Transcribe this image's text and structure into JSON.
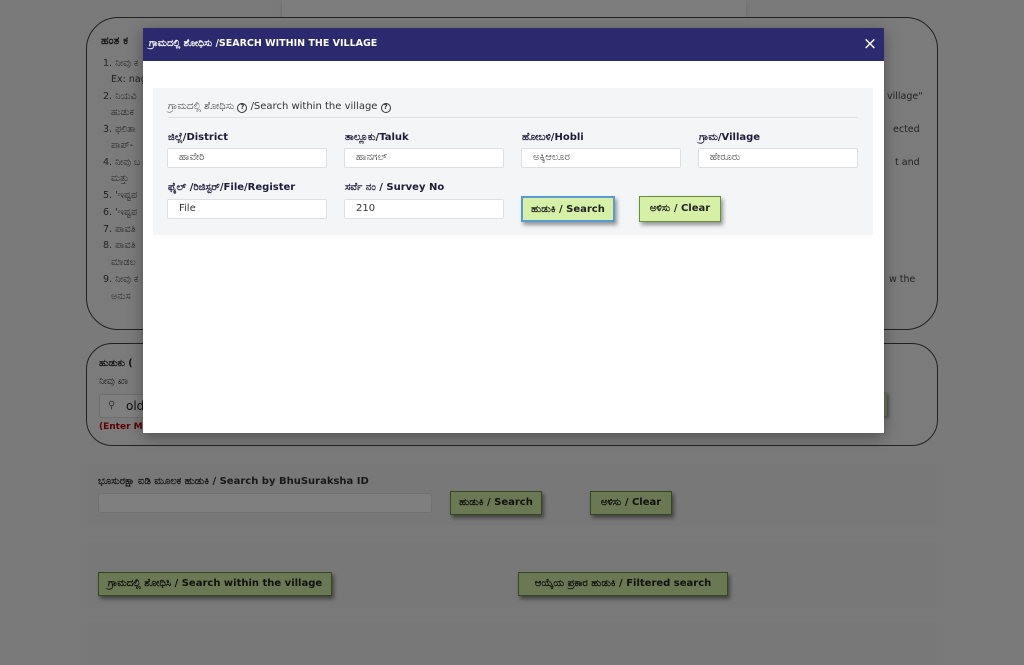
{
  "background": {
    "steps_title": "ಹಂತ ಕ",
    "steps": [
      "1. ನೀವು ಕ",
      "Ex: nag",
      "2. ನಿಯವಿ",
      "ಹುಡುಕ",
      "3. ಫಲಿತಾ",
      "ಪಾಪ್-",
      "4. ನೀವು ಬ",
      "ಮತ್ತು ",
      "5. 'ಇಷ್ಟಪ",
      "6. 'ಇಷ್ಟಪ",
      "7. ಪಾವತಿ",
      "8. ಪಾವತಿ",
      "ಮಾಡಲ",
      "9. ನೀವು ಕ",
      "ಅನುಸ"
    ],
    "steps_right": [
      "village\"",
      "ected",
      "t and",
      "w the"
    ],
    "search_title": "ಹುಡುಕು (",
    "search_subtitle": "ನೀವು ಖಾ",
    "search_value": "old",
    "search_hint": "(Enter Mi",
    "bhusuraksha_label": "ಭೂಸುರಕ್ಷಾ ಐಡಿ ಮೂಲಕ ಹುಡುಕಿ / Search by BhuSuraksha ID",
    "bhusuraksha_search_button": "ಹುಡುಕಿ / Search",
    "bhusuraksha_clear_button": "ಅಳಿಸು / Clear",
    "village_search_button": "ಗ್ರಾಮದಲ್ಲಿ ಶೋಧಿಸಿ / Search within the village",
    "filtered_search_button": "ಆಯ್ಕೆಯ ಪ್ರಕಾರ ಹುಡುಕಿ / Filtered search"
  },
  "modal": {
    "title": "ಗ್ರಾಮದಲ್ಲಿ ಶೋಧಿಸು /SEARCH WITHIN THE VILLAGE",
    "close_icon": "×",
    "section_title_kn": "ಗ್ರಾಮದಲ್ಲಿ ಶೋಧಿಸು",
    "section_title_en": "/Search within the village",
    "help_icon": "?",
    "fields": {
      "district": {
        "label": "ಜಿಲ್ಲೆ/District",
        "value": "ಹಾವೇರಿ"
      },
      "taluk": {
        "label": "ತಾಲ್ಲೂಕು/Taluk",
        "value": "ಹಾನಗಲ್"
      },
      "hobli": {
        "label": "ಹೋಬಳಿ/Hobli",
        "value": "ಅಕ್ಕಿಆಲೂರ"
      },
      "village": {
        "label": "ಗ್ರಾಮ/Village",
        "value": "ಹೇರೂರು"
      },
      "file_register": {
        "label": "ಫೈಲ್ /ರಿಜಿಸ್ಟರ್/File/Register",
        "value": "File"
      },
      "survey_no": {
        "label": "ಸರ್ವೆ ನಂ / Survey No",
        "value": "210"
      }
    },
    "search_button": "ಹುಡುಕಿ / Search",
    "clear_button": "ಅಳಿಸು / Clear"
  },
  "colors": {
    "modal_header": "#2b2a6e",
    "button_green": "#d7f0a8",
    "hint_red": "#b00000"
  }
}
